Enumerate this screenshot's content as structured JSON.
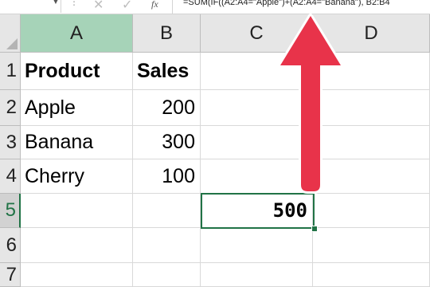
{
  "formula_bar": {
    "dropdown_glyph": "▼",
    "dots": "⋮",
    "cancel_glyph": "✕",
    "enter_glyph": "✓",
    "fx_label": "fx",
    "formula": "=SUM(IF((A2:A4=\"Apple\")+(A2:A4=\"Banana\"), B2:B4"
  },
  "columns": [
    "A",
    "B",
    "C",
    "D"
  ],
  "rows": [
    "1",
    "2",
    "3",
    "4",
    "5",
    "6",
    "7"
  ],
  "cells": {
    "A1": "Product",
    "B1": "Sales",
    "A2": "Apple",
    "B2": "200",
    "A3": "Banana",
    "B3": "300",
    "A4": "Cherry",
    "B4": "100",
    "C5": "500"
  },
  "colors": {
    "selection": "#217346",
    "selected_header": "#a6d3b8",
    "arrow": "#e8334a"
  }
}
